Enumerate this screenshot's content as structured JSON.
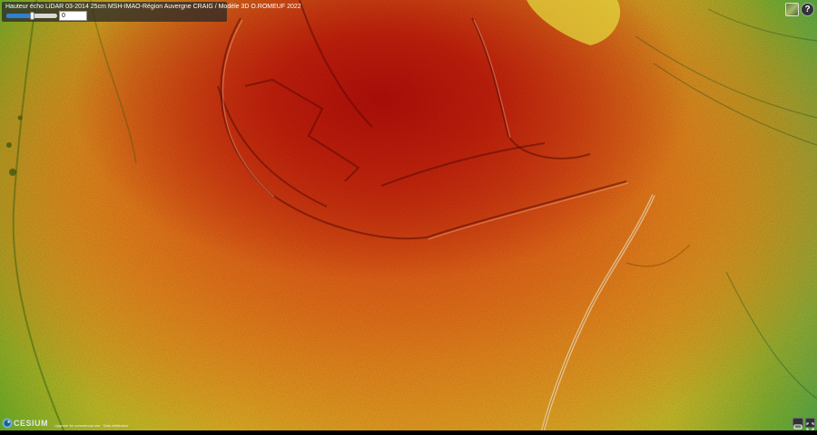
{
  "layer_panel": {
    "title": "Hauteur écho LiDAR 03-2014 25cm MSH-IMAO-Région Auvergne CRAIG / Modèle 3D O.ROMEUF 2022",
    "opacity_fraction": 0.5,
    "value": "0"
  },
  "toolbar": {
    "base_layer_icon": "layers-thumbnail-icon",
    "help_label": "?",
    "help_icon": "question-mark-icon"
  },
  "credits": {
    "logo_text": "CESIUM",
    "logo_icon": "cesium-globe-icon",
    "links_text": "Upgrade for commercial use · Data attribution"
  },
  "controls": {
    "vr_icon": "vr-headset-icon",
    "fullscreen_icon": "fullscreen-icon"
  },
  "colors": {
    "peak": "#b80f0a",
    "mid": "#e86418",
    "low": "#d8cc2c",
    "lowest": "#2aae55"
  }
}
